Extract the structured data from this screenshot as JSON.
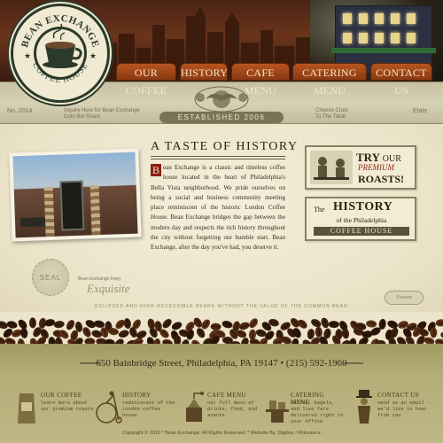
{
  "brand": {
    "name_top": "BEAN EXCHANGE",
    "name_bottom": "COFFEE HOUSE",
    "colors": {
      "header_brown": "#4a2414",
      "nav_orange": "#b8541f",
      "cream": "#f1ead2",
      "dark_green": "#2b3a2b",
      "footer_olive": "#b4ad78"
    }
  },
  "nav": {
    "items": [
      {
        "label": "OUR COFFEE"
      },
      {
        "label": "HISTORY"
      },
      {
        "label": "CAFE MENU"
      },
      {
        "label": "CATERING MENU"
      },
      {
        "label": "CONTACT US"
      }
    ]
  },
  "band": {
    "left_no": "No. 2014",
    "left_small_1": "Inquire Here for Bean Exchange",
    "left_small_2": "Gold Bar Roast",
    "right_small_1": "Cheese Crust",
    "right_small_2": "To The Table",
    "right_label": "Etats",
    "established": "ESTABLISHED 2006"
  },
  "story": {
    "title": "A TASTE OF HISTORY",
    "dropcap": "B",
    "body": "ean Exchange is a classic and timeless coffee house located in the heart of Philadelphia's Bella Vista neighborhood. We pride ourselves on being a social and business community meeting place reminiscent of the historic London Coffee House. Bean Exchange bridges the gap between the modern day and respects the rich history throughout the city without forgetting our humble start. Bean Exchange, after the day you've had, you deserve it."
  },
  "promos": {
    "try": "TRY",
    "our": "OUR",
    "premium": "PREMIUM",
    "roasts": "ROASTS!",
    "the": "The",
    "history": "HISTORY",
    "of_the": "of the Philadelphia",
    "coffee_house": "COFFEE HOUSE"
  },
  "seal": {
    "label": "SEAL",
    "sig_caption": "Bean Exchange Inspy",
    "signature": "Exquisite",
    "tagline": "ECLIPSED AND HIGH-ACCESSIBLE BEANS WITHOUT THE VALUE OF THE COMMON BEAN",
    "right_label": "Esteem"
  },
  "footer": {
    "address": "650 Bainbridge Street, Philadelphia, PA 19147 • (215) 592-1960",
    "columns": [
      {
        "title": "OUR COFFEE",
        "desc": "learn more about our premium roasts",
        "icon": "coffee-bag-icon"
      },
      {
        "title": "HISTORY",
        "desc": "reminiscent of the London coffee house",
        "icon": "penny-farthing-icon"
      },
      {
        "title": "CAFE MENU",
        "desc": "our full menu of drinks, food, and snacks",
        "icon": "coffee-grinder-icon"
      },
      {
        "title": "CATERING MENU",
        "desc": "coffee, bagels, and live fare delivered right to your office",
        "icon": "serving-tray-icon"
      },
      {
        "title": "CONTACT US",
        "desc": "send us an email - we'd like to hear from you",
        "icon": "gentleman-icon"
      }
    ],
    "copyright": "Copyright © 2010 * Bean Exchange. All Rights Reserved. * Website By: Digibox / Kliksource"
  }
}
